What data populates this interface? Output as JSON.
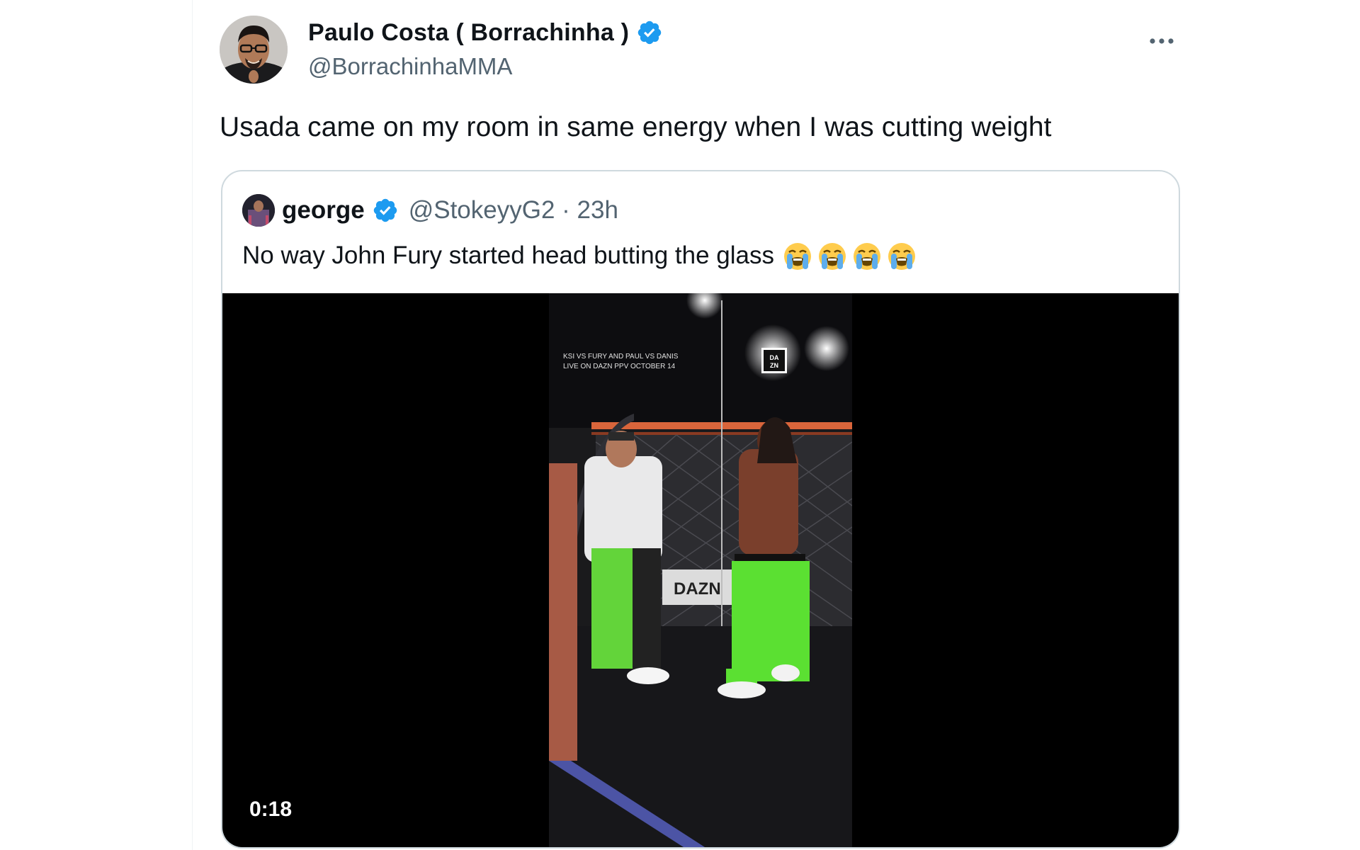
{
  "author": {
    "display_name": "Paulo Costa ( Borrachinha )",
    "handle": "@BorrachinhaMMA",
    "verified": true
  },
  "tweet": {
    "text": "Usada came on my room in same energy when I was cutting weight"
  },
  "quoted_tweet": {
    "display_name": "george",
    "handle_time": "@StokeyyG2 · 23h",
    "verified": true,
    "text": "No way John Fury started head butting the glass",
    "emojis": [
      "loudly-crying-face",
      "loudly-crying-face",
      "loudly-crying-face",
      "loudly-crying-face"
    ],
    "video": {
      "duration": "0:18",
      "overlay_caption": "KSI VS FURY AND PAUL VS DANIS LIVE ON DAZN PPV OCTOBER 14",
      "logo": "DA ZN"
    }
  },
  "colors": {
    "verified": "#1d9bf0",
    "secondary_text": "#536471",
    "border": "#cfd9de"
  }
}
